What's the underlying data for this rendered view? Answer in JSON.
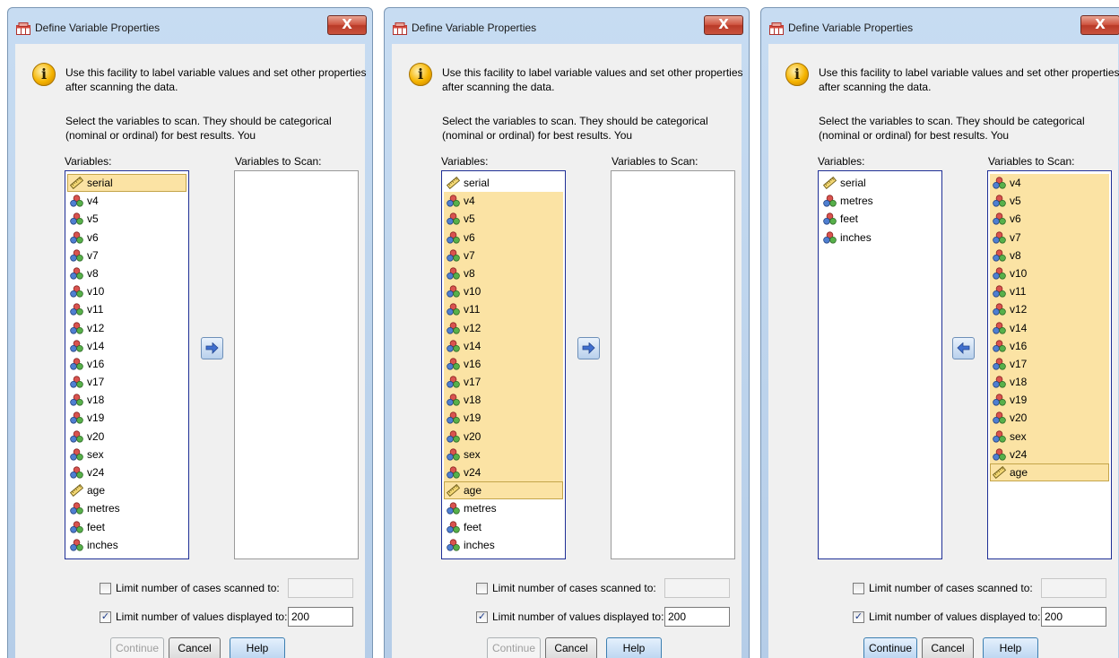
{
  "dialogs": [
    {
      "title": "Define Variable Properties",
      "close_label": "X",
      "info_icon_glyph": "i",
      "intro_text": "Use this facility to label variable values and set other properties after scanning the data.",
      "instruction_text": "Select the variables to scan. They should be categorical (nominal or ordinal) for best results. You",
      "variables_label": "Variables:",
      "scan_label": "Variables to Scan:",
      "variables": [
        {
          "name": "serial",
          "type": "scale",
          "selected": true,
          "focus": true
        },
        {
          "name": "v4",
          "type": "nominal"
        },
        {
          "name": "v5",
          "type": "nominal"
        },
        {
          "name": "v6",
          "type": "nominal"
        },
        {
          "name": "v7",
          "type": "nominal"
        },
        {
          "name": "v8",
          "type": "nominal"
        },
        {
          "name": "v10",
          "type": "nominal"
        },
        {
          "name": "v11",
          "type": "nominal"
        },
        {
          "name": "v12",
          "type": "nominal"
        },
        {
          "name": "v14",
          "type": "nominal"
        },
        {
          "name": "v16",
          "type": "nominal"
        },
        {
          "name": "v17",
          "type": "nominal"
        },
        {
          "name": "v18",
          "type": "nominal"
        },
        {
          "name": "v19",
          "type": "nominal"
        },
        {
          "name": "v20",
          "type": "nominal"
        },
        {
          "name": "sex",
          "type": "nominal"
        },
        {
          "name": "v24",
          "type": "nominal"
        },
        {
          "name": "age",
          "type": "scale"
        },
        {
          "name": "metres",
          "type": "nominal"
        },
        {
          "name": "feet",
          "type": "nominal"
        },
        {
          "name": "inches",
          "type": "nominal"
        }
      ],
      "scan_variables": [],
      "arrow_direction": "right",
      "limit_cases_label": "Limit number of cases scanned to:",
      "limit_cases_checked": false,
      "limit_cases_value": "",
      "limit_values_label": "Limit number of values displayed to:",
      "limit_values_checked": true,
      "limit_values_value": "200",
      "continue_label": "Continue",
      "continue_enabled": false,
      "cancel_label": "Cancel",
      "help_label": "Help"
    },
    {
      "title": "Define Variable Properties",
      "close_label": "X",
      "info_icon_glyph": "i",
      "intro_text": "Use this facility to label variable values and set other properties after scanning the data.",
      "instruction_text": "Select the variables to scan. They should be categorical (nominal or ordinal) for best results. You",
      "variables_label": "Variables:",
      "scan_label": "Variables to Scan:",
      "variables": [
        {
          "name": "serial",
          "type": "scale"
        },
        {
          "name": "v4",
          "type": "nominal",
          "selected": true
        },
        {
          "name": "v5",
          "type": "nominal",
          "selected": true
        },
        {
          "name": "v6",
          "type": "nominal",
          "selected": true
        },
        {
          "name": "v7",
          "type": "nominal",
          "selected": true
        },
        {
          "name": "v8",
          "type": "nominal",
          "selected": true
        },
        {
          "name": "v10",
          "type": "nominal",
          "selected": true
        },
        {
          "name": "v11",
          "type": "nominal",
          "selected": true
        },
        {
          "name": "v12",
          "type": "nominal",
          "selected": true
        },
        {
          "name": "v14",
          "type": "nominal",
          "selected": true
        },
        {
          "name": "v16",
          "type": "nominal",
          "selected": true
        },
        {
          "name": "v17",
          "type": "nominal",
          "selected": true
        },
        {
          "name": "v18",
          "type": "nominal",
          "selected": true
        },
        {
          "name": "v19",
          "type": "nominal",
          "selected": true
        },
        {
          "name": "v20",
          "type": "nominal",
          "selected": true
        },
        {
          "name": "sex",
          "type": "nominal",
          "selected": true
        },
        {
          "name": "v24",
          "type": "nominal",
          "selected": true
        },
        {
          "name": "age",
          "type": "scale",
          "selected": true,
          "focus": true
        },
        {
          "name": "metres",
          "type": "nominal"
        },
        {
          "name": "feet",
          "type": "nominal"
        },
        {
          "name": "inches",
          "type": "nominal"
        }
      ],
      "scan_variables": [],
      "arrow_direction": "right",
      "limit_cases_label": "Limit number of cases scanned to:",
      "limit_cases_checked": false,
      "limit_cases_value": "",
      "limit_values_label": "Limit number of values displayed to:",
      "limit_values_checked": true,
      "limit_values_value": "200",
      "continue_label": "Continue",
      "continue_enabled": false,
      "cancel_label": "Cancel",
      "help_label": "Help"
    },
    {
      "title": "Define Variable Properties",
      "close_label": "X",
      "info_icon_glyph": "i",
      "intro_text": "Use this facility to label variable values and set other properties after scanning the data.",
      "instruction_text": "Select the variables to scan. They should be categorical (nominal or ordinal) for best results. You",
      "variables_label": "Variables:",
      "scan_label": "Variables to Scan:",
      "variables": [
        {
          "name": "serial",
          "type": "scale"
        },
        {
          "name": "metres",
          "type": "nominal"
        },
        {
          "name": "feet",
          "type": "nominal"
        },
        {
          "name": "inches",
          "type": "nominal"
        }
      ],
      "scan_variables": [
        {
          "name": "v4",
          "type": "nominal",
          "selected": true
        },
        {
          "name": "v5",
          "type": "nominal",
          "selected": true
        },
        {
          "name": "v6",
          "type": "nominal",
          "selected": true
        },
        {
          "name": "v7",
          "type": "nominal",
          "selected": true
        },
        {
          "name": "v8",
          "type": "nominal",
          "selected": true
        },
        {
          "name": "v10",
          "type": "nominal",
          "selected": true
        },
        {
          "name": "v11",
          "type": "nominal",
          "selected": true
        },
        {
          "name": "v12",
          "type": "nominal",
          "selected": true
        },
        {
          "name": "v14",
          "type": "nominal",
          "selected": true
        },
        {
          "name": "v16",
          "type": "nominal",
          "selected": true
        },
        {
          "name": "v17",
          "type": "nominal",
          "selected": true
        },
        {
          "name": "v18",
          "type": "nominal",
          "selected": true
        },
        {
          "name": "v19",
          "type": "nominal",
          "selected": true
        },
        {
          "name": "v20",
          "type": "nominal",
          "selected": true
        },
        {
          "name": "sex",
          "type": "nominal",
          "selected": true
        },
        {
          "name": "v24",
          "type": "nominal",
          "selected": true
        },
        {
          "name": "age",
          "type": "scale",
          "selected": true,
          "focus": true
        }
      ],
      "arrow_direction": "left",
      "limit_cases_label": "Limit number of cases scanned to:",
      "limit_cases_checked": false,
      "limit_cases_value": "",
      "limit_values_label": "Limit number of values displayed to:",
      "limit_values_checked": true,
      "limit_values_value": "200",
      "continue_label": "Continue",
      "continue_enabled": true,
      "cancel_label": "Cancel",
      "help_label": "Help"
    }
  ]
}
